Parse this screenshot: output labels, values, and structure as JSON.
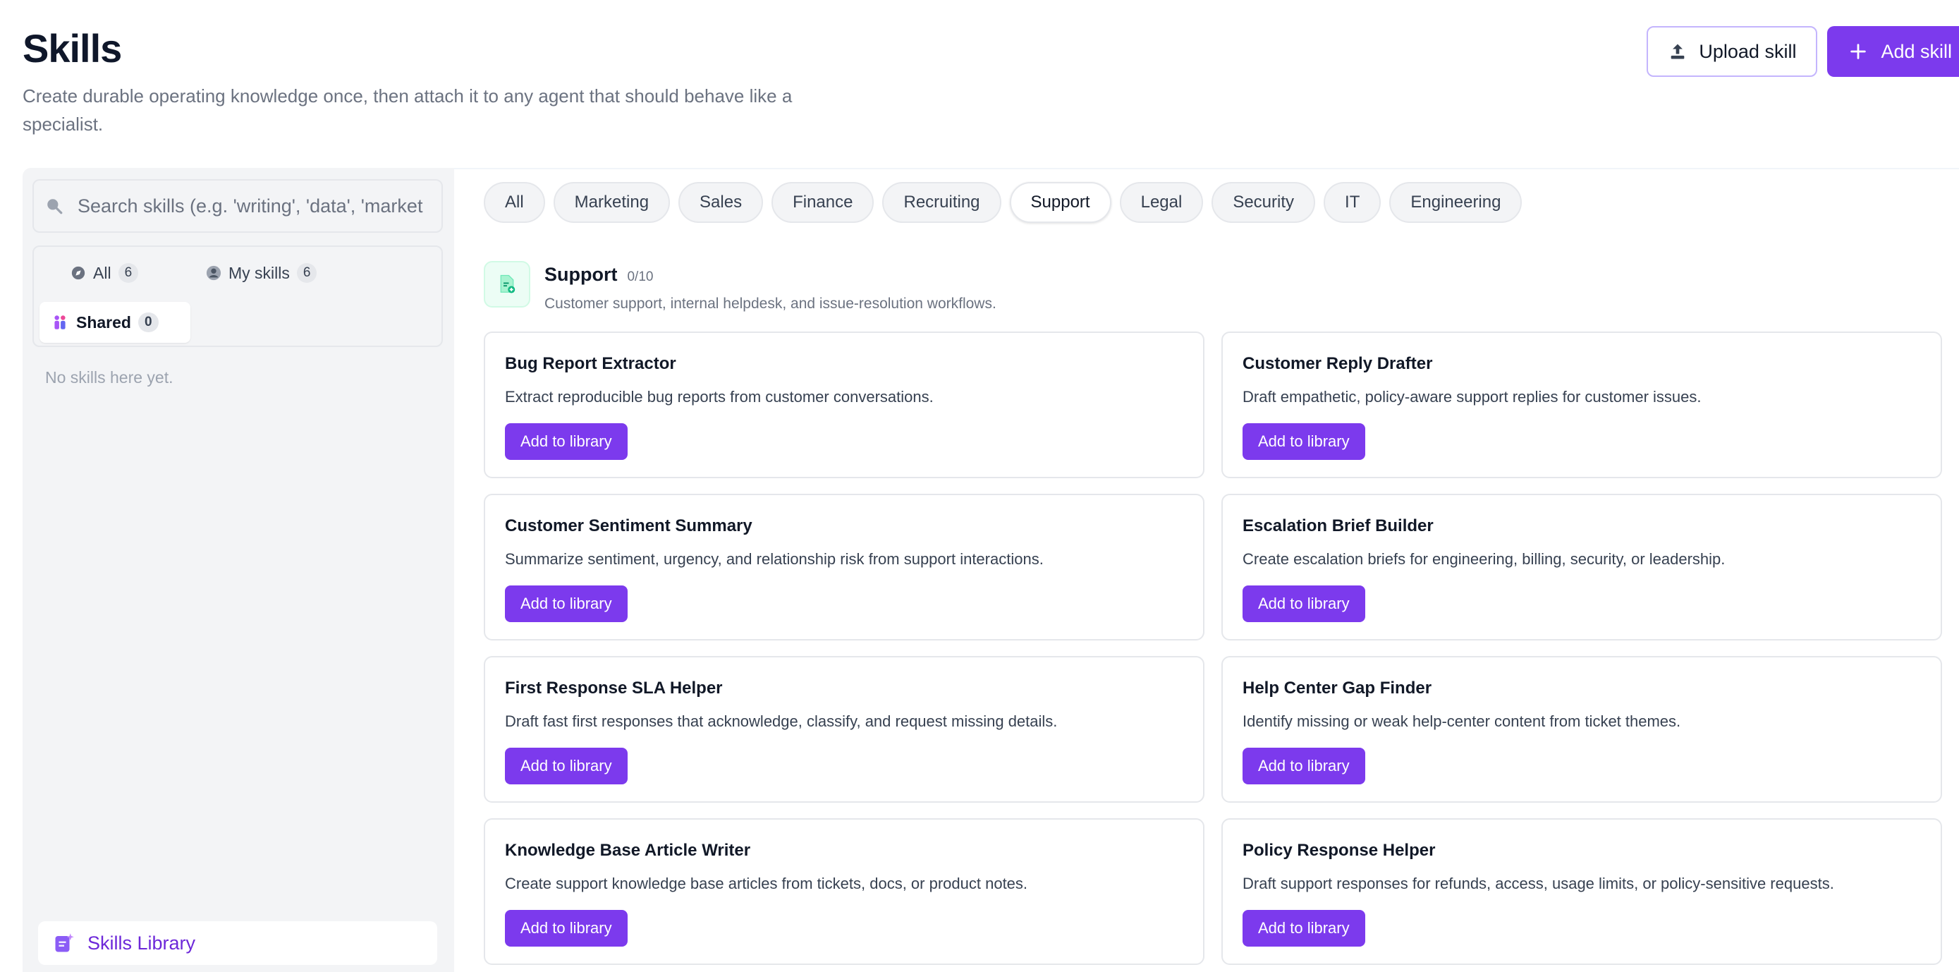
{
  "header": {
    "title": "Skills",
    "subtitle": "Create durable operating knowledge once, then attach it to any agent that should behave like a specialist."
  },
  "actions": {
    "upload_label": "Upload skill",
    "add_label": "Add skill",
    "upload_icon": "upload-icon",
    "add_icon": "plus-icon"
  },
  "sidebar": {
    "search_placeholder": "Search skills (e.g. 'writing', 'data', 'marketing')",
    "tabs": [
      {
        "label": "All",
        "count": "6",
        "icon": "compass-icon"
      },
      {
        "label": "My skills",
        "count": "6",
        "icon": "user-icon"
      },
      {
        "label": "Shared",
        "count": "0",
        "icon": "people-icon",
        "active": true
      }
    ],
    "empty_text": "No skills here yet.",
    "library_label": "Skills Library"
  },
  "categories": [
    {
      "label": "All"
    },
    {
      "label": "Marketing"
    },
    {
      "label": "Sales"
    },
    {
      "label": "Finance"
    },
    {
      "label": "Recruiting"
    },
    {
      "label": "Support",
      "active": true
    },
    {
      "label": "Legal"
    },
    {
      "label": "Security"
    },
    {
      "label": "IT"
    },
    {
      "label": "Engineering"
    }
  ],
  "category": {
    "title": "Support",
    "count": "0/10",
    "description": "Customer support, internal helpdesk, and issue-resolution workflows."
  },
  "skills": [
    {
      "title": "Bug Report Extractor",
      "description": "Extract reproducible bug reports from customer conversations.",
      "button": "Add to library"
    },
    {
      "title": "Customer Reply Drafter",
      "description": "Draft empathetic, policy-aware support replies for customer issues.",
      "button": "Add to library"
    },
    {
      "title": "Customer Sentiment Summary",
      "description": "Summarize sentiment, urgency, and relationship risk from support interactions.",
      "button": "Add to library"
    },
    {
      "title": "Escalation Brief Builder",
      "description": "Create escalation briefs for engineering, billing, security, or leadership.",
      "button": "Add to library"
    },
    {
      "title": "First Response SLA Helper",
      "description": "Draft fast first responses that acknowledge, classify, and request missing details.",
      "button": "Add to library"
    },
    {
      "title": "Help Center Gap Finder",
      "description": "Identify missing or weak help-center content from ticket themes.",
      "button": "Add to library"
    },
    {
      "title": "Knowledge Base Article Writer",
      "description": "Create support knowledge base articles from tickets, docs, or product notes.",
      "button": "Add to library"
    },
    {
      "title": "Policy Response Helper",
      "description": "Draft support responses for refunds, access, usage limits, or policy-sensitive requests.",
      "button": "Add to library"
    }
  ],
  "colors": {
    "accent": "#7c3aed",
    "accent_light": "#c4b5fd",
    "category_icon_bg": "#ecfdf5"
  }
}
